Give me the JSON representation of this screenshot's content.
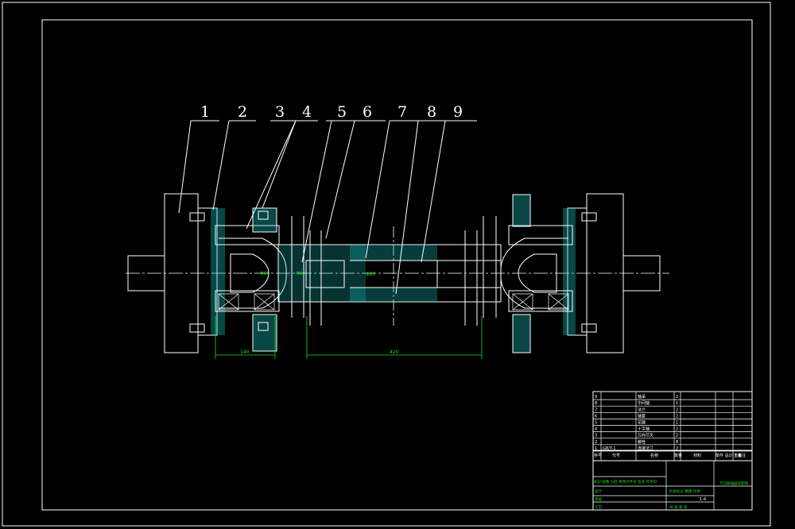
{
  "drawing": {
    "balloons": [
      "1",
      "2",
      "3",
      "4",
      "5",
      "6",
      "7",
      "8",
      "9"
    ],
    "dimensions": {
      "left_span": "140",
      "middle_span": "420"
    },
    "inline_dims": [
      "Φ60",
      "Φ60",
      "Φ60"
    ]
  },
  "title_block": {
    "bom_rows": [
      {
        "no": "9",
        "code": "",
        "name": "轴承",
        "qty": "2",
        "material": "",
        "weight": "",
        "remark": ""
      },
      {
        "no": "8",
        "code": "",
        "name": "中间轴",
        "qty": "1",
        "material": "",
        "weight": "",
        "remark": ""
      },
      {
        "no": "7",
        "code": "",
        "name": "法兰",
        "qty": "2",
        "material": "",
        "weight": "",
        "remark": ""
      },
      {
        "no": "6",
        "code": "",
        "name": "轴套",
        "qty": "2",
        "material": "",
        "weight": "",
        "remark": ""
      },
      {
        "no": "5",
        "code": "",
        "name": "花键",
        "qty": "1",
        "material": "",
        "weight": "",
        "remark": ""
      },
      {
        "no": "4",
        "code": "",
        "name": "十字轴",
        "qty": "2",
        "material": "",
        "weight": "",
        "remark": ""
      },
      {
        "no": "3",
        "code": "",
        "name": "万向节叉",
        "qty": "2",
        "material": "",
        "weight": "",
        "remark": ""
      },
      {
        "no": "2",
        "code": "",
        "name": "螺栓",
        "qty": "8",
        "material": "",
        "weight": "",
        "remark": ""
      },
      {
        "no": "1",
        "code": "GB/T-1",
        "name": "连接法兰",
        "qty": "2",
        "material": "",
        "weight": "",
        "remark": ""
      }
    ],
    "header": {
      "no": "序号",
      "code": "代号",
      "name": "名称",
      "qty": "数量",
      "material": "材料",
      "weight": "单件 总计 重量",
      "remark": "备注"
    },
    "drawing_title": "万向联轴器装配图",
    "sign_rows": [
      "标记 处数 分区 更改文件号 签名 年月日",
      "设计",
      "审核",
      "工艺"
    ],
    "scale_label": "阶段标记 重量 比例",
    "scale_value": "1:4",
    "sheet": "共 张 第 张"
  }
}
